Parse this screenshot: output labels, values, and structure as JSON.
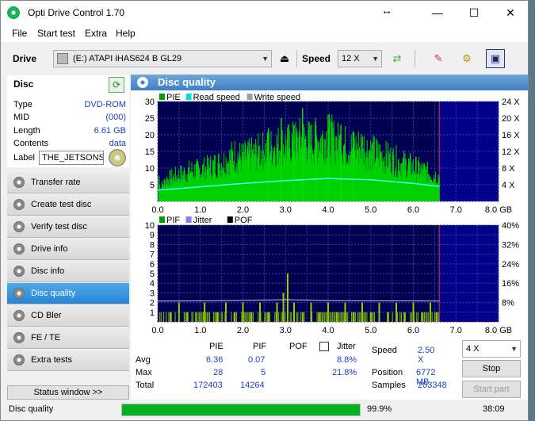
{
  "window": {
    "title": "Opti Drive Control 1.70"
  },
  "menu": [
    "File",
    "Start test",
    "Extra",
    "Help"
  ],
  "toolbar": {
    "drive_label": "Drive",
    "drive_value": "(E:)   ATAPI iHAS624   B GL29",
    "speed_label": "Speed",
    "speed_value": "12 X"
  },
  "disc": {
    "heading": "Disc",
    "rows": [
      {
        "key": "Type",
        "value": "DVD-ROM"
      },
      {
        "key": "MID",
        "value": "(000)"
      },
      {
        "key": "Length",
        "value": "6.61 GB"
      },
      {
        "key": "Contents",
        "value": "data"
      }
    ],
    "label_key": "Label",
    "label_value": "THE_JETSONS_"
  },
  "nav": [
    "Transfer rate",
    "Create test disc",
    "Verify test disc",
    "Drive info",
    "Disc info",
    "Disc quality",
    "CD Bler",
    "FE / TE",
    "Extra tests"
  ],
  "nav_active": "Disc quality",
  "status_window_label": "Status window >>",
  "panel": {
    "title": "Disc quality"
  },
  "chart_data": [
    {
      "type": "bar",
      "legend": [
        "PIE",
        "Read speed",
        "Write speed"
      ],
      "legend_colors": [
        "#00a000",
        "#00e0e0",
        "#a0a0a0"
      ],
      "x_ticks": [
        "0.0",
        "1.0",
        "2.0",
        "3.0",
        "4.0",
        "5.0",
        "6.0",
        "7.0",
        "8.0 GB"
      ],
      "y_left_ticks": [
        "30",
        "25",
        "20",
        "15",
        "10",
        "5"
      ],
      "y_right_ticks": [
        "24 X",
        "20 X",
        "16 X",
        "12 X",
        "8 X",
        "4 X"
      ],
      "xlim": [
        0,
        8
      ],
      "ylim": [
        0,
        30
      ],
      "data_end": 6.61,
      "pie_profile": [
        [
          0.05,
          4
        ],
        [
          0.2,
          7
        ],
        [
          0.4,
          8
        ],
        [
          0.6,
          9
        ],
        [
          0.8,
          10
        ],
        [
          1.0,
          10
        ],
        [
          1.2,
          11
        ],
        [
          1.4,
          12
        ],
        [
          1.6,
          13
        ],
        [
          1.8,
          15
        ],
        [
          2.0,
          14
        ],
        [
          2.2,
          15
        ],
        [
          2.4,
          16
        ],
        [
          2.6,
          17
        ],
        [
          2.8,
          18
        ],
        [
          3.0,
          18
        ],
        [
          3.2,
          19
        ],
        [
          3.4,
          20
        ],
        [
          3.6,
          19
        ],
        [
          3.8,
          20
        ],
        [
          4.0,
          21
        ],
        [
          4.2,
          19
        ],
        [
          4.4,
          18
        ],
        [
          4.6,
          17
        ],
        [
          4.8,
          18
        ],
        [
          5.0,
          16
        ],
        [
          5.2,
          15
        ],
        [
          5.4,
          14
        ],
        [
          5.6,
          13
        ],
        [
          5.8,
          12
        ],
        [
          6.0,
          11
        ],
        [
          6.2,
          10
        ],
        [
          6.4,
          9
        ],
        [
          6.6,
          8
        ]
      ],
      "pie_peaks": [
        [
          2.6,
          22
        ],
        [
          2.9,
          25
        ],
        [
          3.2,
          23
        ],
        [
          3.4,
          28
        ],
        [
          3.7,
          24
        ],
        [
          4.0,
          26
        ],
        [
          4.3,
          23
        ],
        [
          4.6,
          21
        ]
      ],
      "read_speed": [
        [
          0.0,
          2.7
        ],
        [
          1.0,
          3.5
        ],
        [
          2.0,
          4.3
        ],
        [
          3.0,
          5.0
        ],
        [
          4.0,
          5.5
        ],
        [
          5.0,
          5.2
        ],
        [
          6.0,
          4.3
        ],
        [
          6.61,
          3.6
        ]
      ]
    },
    {
      "type": "bar",
      "legend": [
        "PIF",
        "Jitter",
        "POF"
      ],
      "legend_colors": [
        "#00a000",
        "#8080ff",
        "#000000"
      ],
      "x_ticks": [
        "0.0",
        "1.0",
        "2.0",
        "3.0",
        "4.0",
        "5.0",
        "6.0",
        "7.0",
        "8.0 GB"
      ],
      "y_left_ticks": [
        "10",
        "9",
        "8",
        "7",
        "6",
        "5",
        "4",
        "3",
        "2",
        "1"
      ],
      "y_right_ticks": [
        "40%",
        "32%",
        "24%",
        "16%",
        "8%"
      ],
      "xlim": [
        0,
        8
      ],
      "ylim": [
        0,
        10
      ],
      "data_end": 6.61,
      "pif_bars": [
        [
          0.3,
          1
        ],
        [
          0.5,
          2
        ],
        [
          0.7,
          1
        ],
        [
          0.9,
          1
        ],
        [
          1.1,
          2
        ],
        [
          1.4,
          1
        ],
        [
          1.6,
          2
        ],
        [
          1.8,
          1
        ],
        [
          2.0,
          2
        ],
        [
          2.2,
          1
        ],
        [
          2.4,
          2
        ],
        [
          2.6,
          1
        ],
        [
          2.8,
          2
        ],
        [
          2.95,
          3
        ],
        [
          3.05,
          5
        ],
        [
          3.2,
          2
        ],
        [
          3.4,
          1
        ],
        [
          3.6,
          2
        ],
        [
          3.8,
          1
        ],
        [
          4.0,
          2
        ],
        [
          4.2,
          1
        ],
        [
          4.4,
          2
        ],
        [
          4.6,
          1
        ],
        [
          4.8,
          2
        ],
        [
          5.0,
          1
        ],
        [
          5.2,
          2
        ],
        [
          5.4,
          1
        ],
        [
          5.6,
          2
        ],
        [
          5.8,
          1
        ],
        [
          6.0,
          2
        ],
        [
          6.2,
          1
        ],
        [
          6.4,
          2
        ],
        [
          6.55,
          1
        ]
      ],
      "jitter": [
        [
          0.0,
          8.6
        ],
        [
          1.0,
          8.7
        ],
        [
          2.0,
          8.9
        ],
        [
          3.0,
          9.2
        ],
        [
          4.0,
          8.8
        ],
        [
          5.0,
          8.7
        ],
        [
          6.0,
          8.7
        ],
        [
          6.61,
          8.6
        ]
      ],
      "jitter_ylim": [
        0,
        40
      ]
    }
  ],
  "stats": {
    "headers": [
      "PIE",
      "PIF",
      "POF",
      "Jitter"
    ],
    "rows": [
      {
        "label": "Avg",
        "pie": "6.36",
        "pif": "0.07",
        "jitter": "8.8%"
      },
      {
        "label": "Max",
        "pie": "28",
        "pif": "5",
        "jitter": "21.8%"
      },
      {
        "label": "Total",
        "pie": "172403",
        "pif": "14264",
        "jitter": ""
      }
    ],
    "speed_label": "Speed",
    "speed_value": "2.50 X",
    "position_label": "Position",
    "position_value": "6772 MB",
    "samples_label": "Samples",
    "samples_value": "203348",
    "speed_select": "4 X",
    "stop_label": "Stop",
    "start_part_label": "Start part"
  },
  "statusbar": {
    "text": "Disc quality",
    "progress": 0.999,
    "percent": "99.9%",
    "time": "38:09"
  }
}
